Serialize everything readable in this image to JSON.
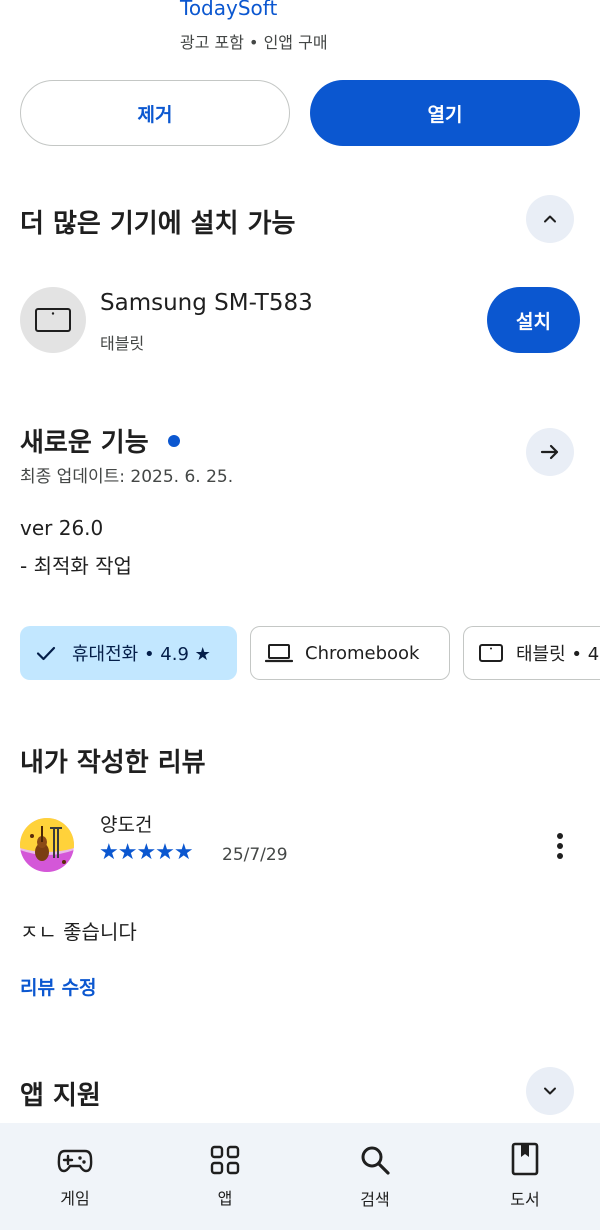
{
  "app": {
    "developer": "TodaySoft",
    "meta": "광고 포함  •  인앱 구매"
  },
  "actions": {
    "uninstall_label": "제거",
    "open_label": "열기"
  },
  "more_devices": {
    "title": "더 많은 기기에 설치 가능",
    "device_name": "Samsung SM-T583",
    "device_type": "태블릿",
    "install_label": "설치"
  },
  "whats_new": {
    "title": "새로운 기능",
    "updated": "최종 업데이트: 2025. 6. 25.",
    "version": "ver 26.0",
    "note": "- 최적화 작업"
  },
  "chips": {
    "phone": "휴대전화 • 4.9 ★",
    "chromebook": "Chromebook",
    "tablet": "태블릿 • 4"
  },
  "my_review": {
    "title": "내가 작성한 리뷰",
    "author": "양도건",
    "stars": "★★★★★",
    "rating": 5,
    "date": "25/7/29",
    "text": "ㅈㄴ 좋습니다",
    "edit_label": "리뷰 수정"
  },
  "app_support": {
    "title": "앱 지원"
  },
  "bottom_nav": {
    "games": "게임",
    "apps": "앱",
    "search": "검색",
    "books": "도서"
  },
  "colors": {
    "accent": "#0b57d0",
    "chip_selected": "#c2e7ff",
    "nav_bg": "#f0f4f9"
  }
}
